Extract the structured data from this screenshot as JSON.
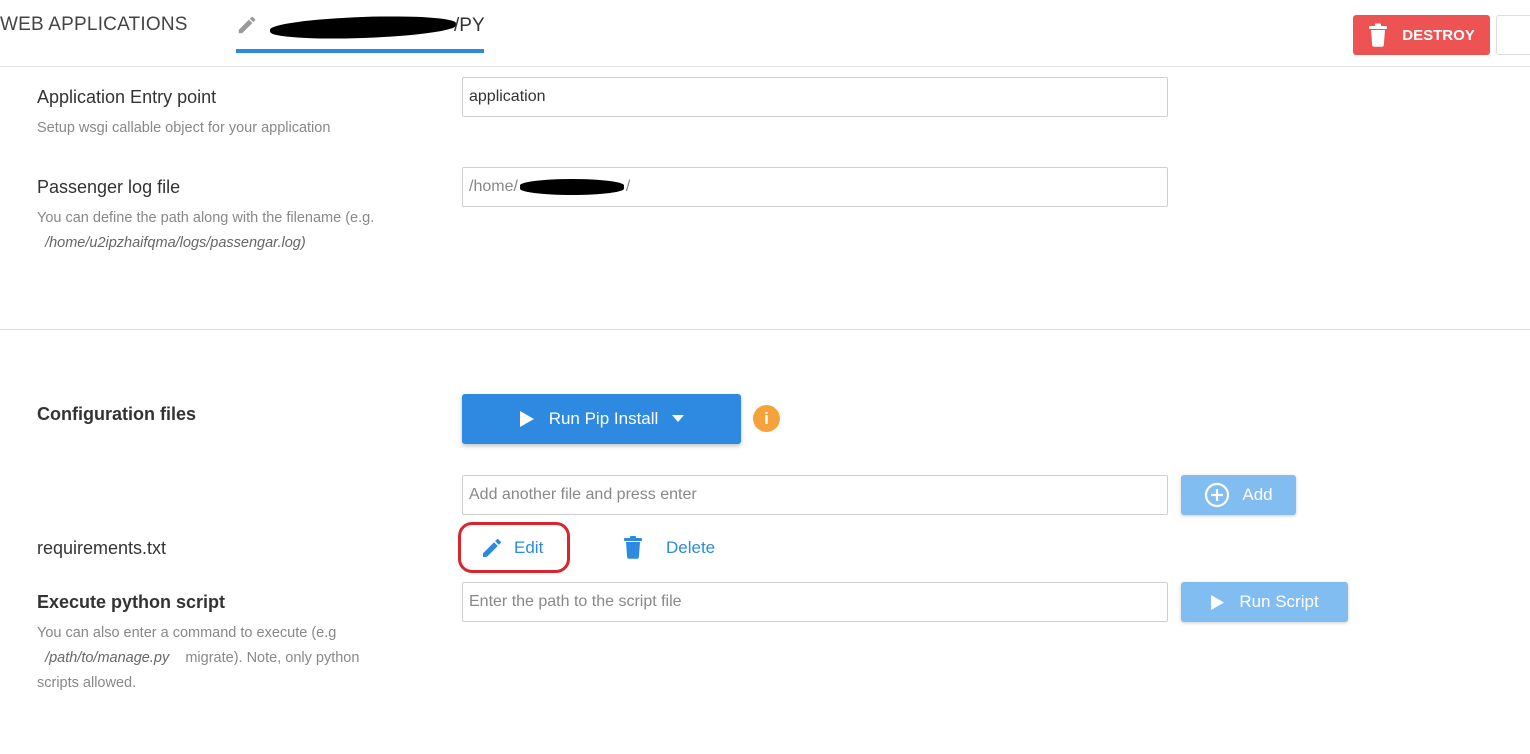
{
  "header": {
    "tab_web_apps": "WEB APPLICATIONS",
    "app_tab_suffix": "/PY",
    "destroy_label": "DESTROY"
  },
  "entry_point": {
    "label": "Application Entry point",
    "hint": "Setup wsgi callable object for your application",
    "value": "application"
  },
  "passenger_log": {
    "label": "Passenger log file",
    "hint_prefix": "You can define the path along with the filename (e.g.",
    "hint_example": "/home/u2ipzhaifqma/logs/passengar.log)",
    "value_prefix": "/home/",
    "value_suffix": "/"
  },
  "config_files": {
    "label": "Configuration files",
    "run_pip_label": "Run Pip Install",
    "info_glyph": "i",
    "add_placeholder": "Add another file and press enter",
    "add_label": "Add",
    "files": [
      {
        "name": "requirements.txt",
        "edit_label": "Edit",
        "delete_label": "Delete"
      }
    ]
  },
  "execute_script": {
    "label": "Execute python script",
    "placeholder": "Enter the path to the script file",
    "run_label": "Run Script",
    "hint_part1": "You can also enter a command to execute (e.g",
    "hint_example": "/path/to/manage.py",
    "hint_part2": "migrate). Note, only python",
    "hint_part3": "scripts allowed."
  },
  "colors": {
    "primary": "#2d8ae0",
    "primary_light": "#81bdf1",
    "danger": "#ee5353",
    "warning": "#f5a23a",
    "highlight_ring": "#d9262d"
  },
  "icons": {
    "tab": "pencil-icon",
    "destroy": "trash-icon",
    "run_pip": "play-icon",
    "run_pip_menu": "caret-down-icon",
    "info": "info-icon",
    "add": "plus-circle-icon",
    "edit": "pencil-icon",
    "delete": "trash-icon",
    "run_script": "play-icon"
  }
}
